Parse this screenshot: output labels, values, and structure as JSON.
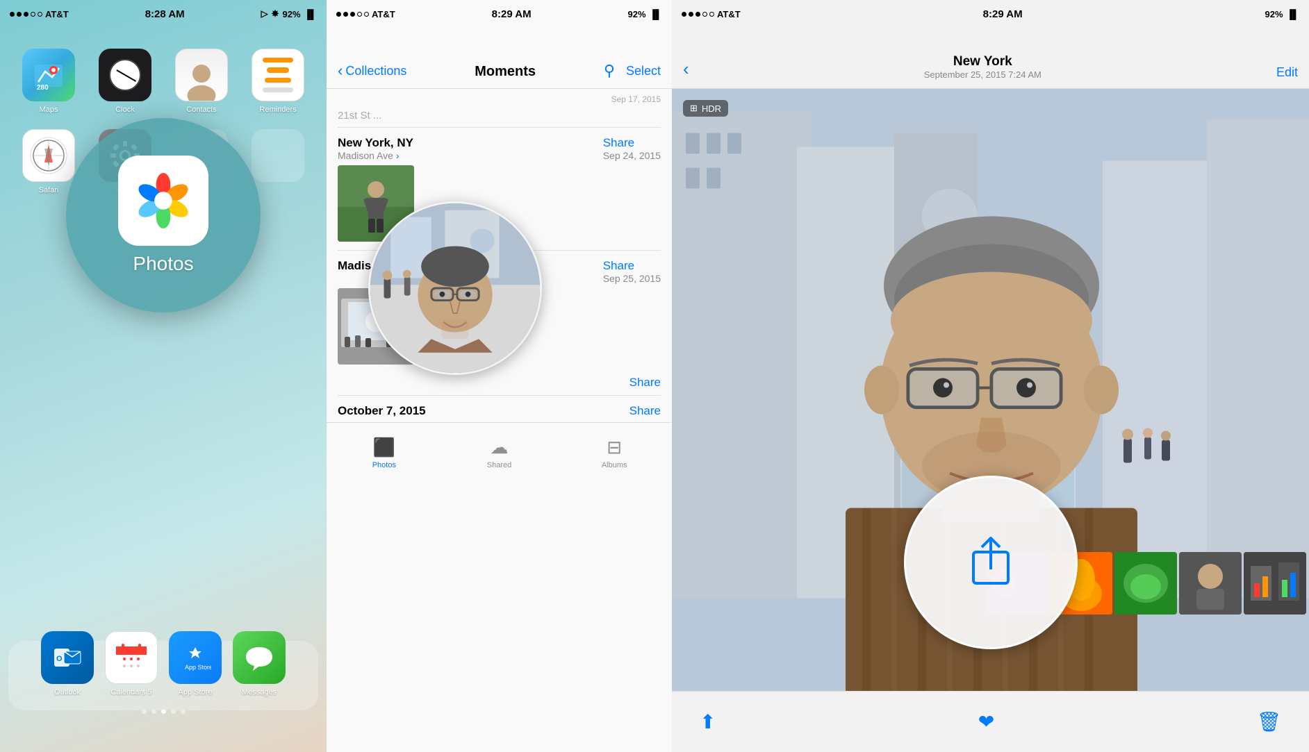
{
  "panel1": {
    "status": {
      "carrier": "AT&T",
      "time": "8:28 AM",
      "battery": "92%"
    },
    "apps": [
      {
        "id": "maps",
        "label": "Maps",
        "icon": "map"
      },
      {
        "id": "clock",
        "label": "Clock",
        "icon": "clock"
      },
      {
        "id": "contacts",
        "label": "Contacts",
        "icon": "contacts"
      },
      {
        "id": "reminders",
        "label": "Reminders",
        "icon": "reminders"
      },
      {
        "id": "safari",
        "label": "Safari",
        "icon": "safari"
      },
      {
        "id": "settings",
        "label": "Settings",
        "icon": "settings"
      },
      {
        "id": "empty1",
        "label": "",
        "icon": "empty"
      },
      {
        "id": "empty2",
        "label": "",
        "icon": "empty"
      }
    ],
    "dock": [
      {
        "id": "outlook",
        "label": "Outlook",
        "icon": "outlook"
      },
      {
        "id": "cal5",
        "label": "Calendars 5",
        "icon": "cal5"
      },
      {
        "id": "appstore",
        "label": "App Store",
        "icon": "appstore"
      },
      {
        "id": "messages",
        "label": "Messages",
        "icon": "messages"
      }
    ],
    "photos_label": "Photos",
    "page_dots": [
      false,
      false,
      true,
      false,
      false
    ]
  },
  "panel2": {
    "status": {
      "carrier": "AT&T",
      "time": "8:29 AM",
      "battery": "92%"
    },
    "nav": {
      "back_label": "Collections",
      "title": "Moments",
      "select_label": "Select"
    },
    "moments": [
      {
        "id": "group1",
        "location": "New York, NY",
        "sublocation": "Madison Ave",
        "date": "Sep 24, 2015",
        "share_label": "Share"
      },
      {
        "id": "group2",
        "location": "Madison Ave",
        "sublocation": "",
        "date": "Sep 25, 2015",
        "share_label": "Share"
      },
      {
        "id": "group3",
        "location": "",
        "sublocation": "",
        "date": "",
        "share_label": "Share"
      },
      {
        "id": "group4",
        "location": "October 7, 2015",
        "sublocation": "",
        "date": "",
        "share_label": "Share"
      }
    ],
    "tabs": [
      {
        "id": "photos",
        "label": "Photos",
        "active": true
      },
      {
        "id": "shared",
        "label": "Shared",
        "active": false
      },
      {
        "id": "albums",
        "label": "Albums",
        "active": false
      }
    ]
  },
  "panel3": {
    "status": {
      "carrier": "AT&T",
      "time": "8:29 AM",
      "battery": "92%"
    },
    "nav": {
      "title": "New York",
      "subtitle": "September 25, 2015  7:24 AM",
      "edit_label": "Edit"
    },
    "hdr_badge": "HDR",
    "bottom_bar": {
      "share_action": "share",
      "like_action": "like",
      "delete_action": "delete"
    }
  }
}
